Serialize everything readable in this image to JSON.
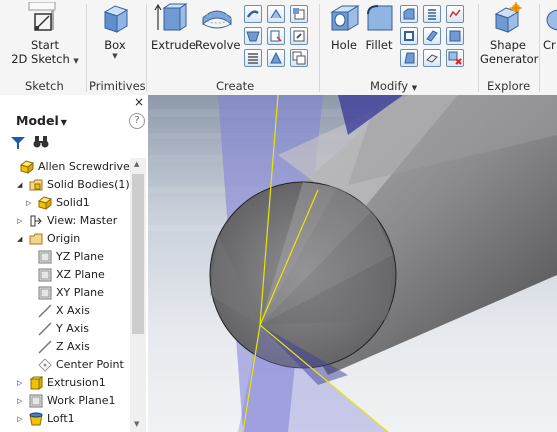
{
  "ribbon": {
    "sketch": {
      "start_label": "Start",
      "sketch_label": "2D Sketch",
      "group": "Sketch"
    },
    "primitives": {
      "box_label": "Box",
      "group": "Primitives"
    },
    "create": {
      "extrude_label": "Extrude",
      "revolve_label": "Revolve",
      "group": "Create"
    },
    "modify": {
      "hole_label": "Hole",
      "fillet_label": "Fillet",
      "group": "Modify"
    },
    "explore": {
      "shape_label": "Shape",
      "generator_label": "Generator",
      "group": "Explore"
    },
    "cut_label": "Cr"
  },
  "browser": {
    "title": "Model",
    "help": "?",
    "close": "×",
    "items": [
      {
        "label": "Allen Screwdriver-"
      },
      {
        "label": "Solid Bodies(1)"
      },
      {
        "label": "Solid1"
      },
      {
        "label": "View: Master"
      },
      {
        "label": "Origin"
      },
      {
        "label": "YZ Plane"
      },
      {
        "label": "XZ Plane"
      },
      {
        "label": "XY Plane"
      },
      {
        "label": "X Axis"
      },
      {
        "label": "Y Axis"
      },
      {
        "label": "Z Axis"
      },
      {
        "label": "Center Point"
      },
      {
        "label": "Extrusion1"
      },
      {
        "label": "Work Plane1"
      },
      {
        "label": "Loft1"
      }
    ]
  },
  "colors": {
    "accent": "#2a5aa8",
    "plane": "#7f7fd8",
    "axis": "#e8e800",
    "body": "#7b7b7b"
  }
}
